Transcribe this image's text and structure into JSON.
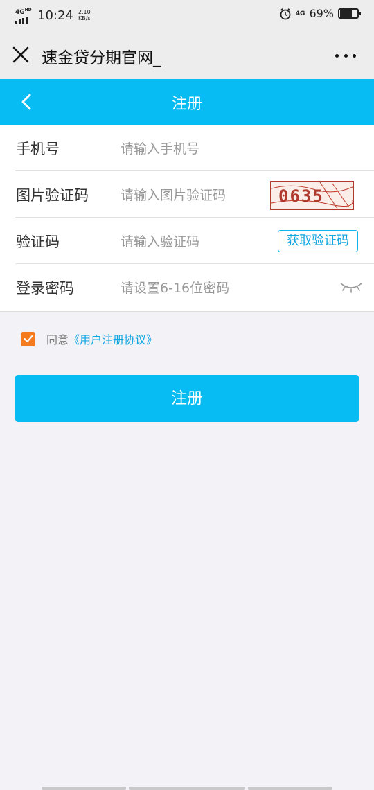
{
  "status_bar": {
    "network": "4G",
    "network_sup": "HD",
    "time": "10:24",
    "speed_value": "2.10",
    "speed_unit": "KB/s",
    "signal_label": "4G",
    "battery_percent": "69%",
    "battery_level": 0.69,
    "alarm_icon": "alarm-clock-icon"
  },
  "titlebar": {
    "title": "速金贷分期官网_",
    "close_icon": "close-icon",
    "more_icon": "more-dots-icon"
  },
  "navbar": {
    "title": "注册",
    "back_icon": "chevron-left-icon",
    "color": "#06bcf2"
  },
  "form": {
    "phone": {
      "label": "手机号",
      "placeholder": "请输入手机号"
    },
    "image_code": {
      "label": "图片验证码",
      "placeholder": "请输入图片验证码",
      "captcha_text": "0635"
    },
    "sms_code": {
      "label": "验证码",
      "placeholder": "请输入验证码",
      "button": "获取验证码"
    },
    "password": {
      "label": "登录密码",
      "placeholder": "请设置6-16位密码",
      "eye_icon": "eye-closed-icon"
    }
  },
  "agreement": {
    "checked": true,
    "prefix": "同意",
    "link": "《用户注册协议》",
    "checkbox_color": "#f47b1e"
  },
  "submit": {
    "label": "注册"
  }
}
